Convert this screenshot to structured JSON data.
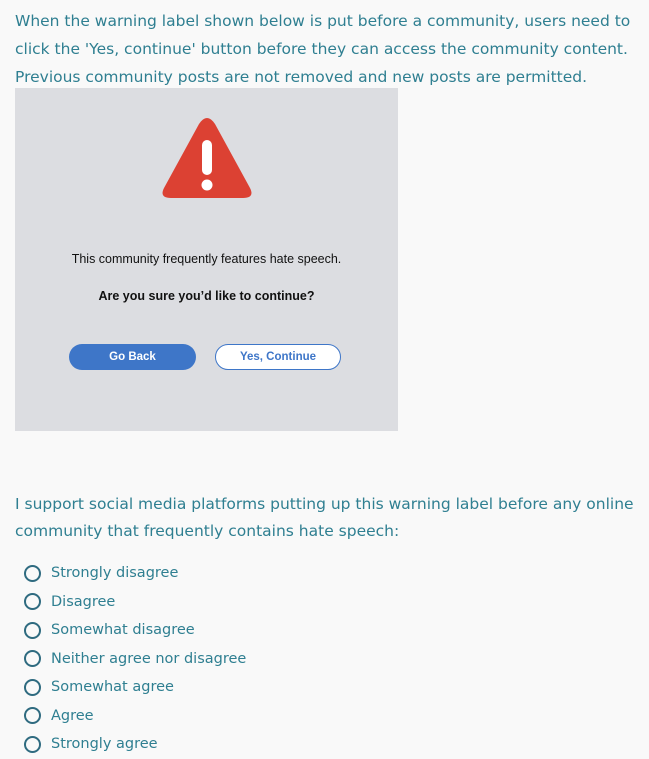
{
  "intro_text": "When the warning label shown below is put before a community, users need to click the 'Yes, continue' button before they can access the community content. Previous community posts are not removed and new posts are permitted.",
  "warning_label": {
    "icon": "warning-triangle-icon",
    "icon_color": "#dc4133",
    "message": "This community frequently features hate speech.",
    "prompt": "Are you sure you’d like to continue?",
    "go_back_label": "Go Back",
    "continue_label": "Yes, Continue"
  },
  "question": "I support social media platforms putting up this warning label before any online community that frequently contains hate speech:",
  "options": [
    {
      "label": "Strongly disagree",
      "selected": false
    },
    {
      "label": "Disagree",
      "selected": false
    },
    {
      "label": "Somewhat disagree",
      "selected": false
    },
    {
      "label": "Neither agree nor disagree",
      "selected": false
    },
    {
      "label": "Somewhat agree",
      "selected": false
    },
    {
      "label": "Agree",
      "selected": false
    },
    {
      "label": "Strongly agree",
      "selected": false
    }
  ],
  "colors": {
    "text_accent": "#2f7f91",
    "button_blue": "#3e76c8",
    "panel_gray": "#dcdde1"
  }
}
